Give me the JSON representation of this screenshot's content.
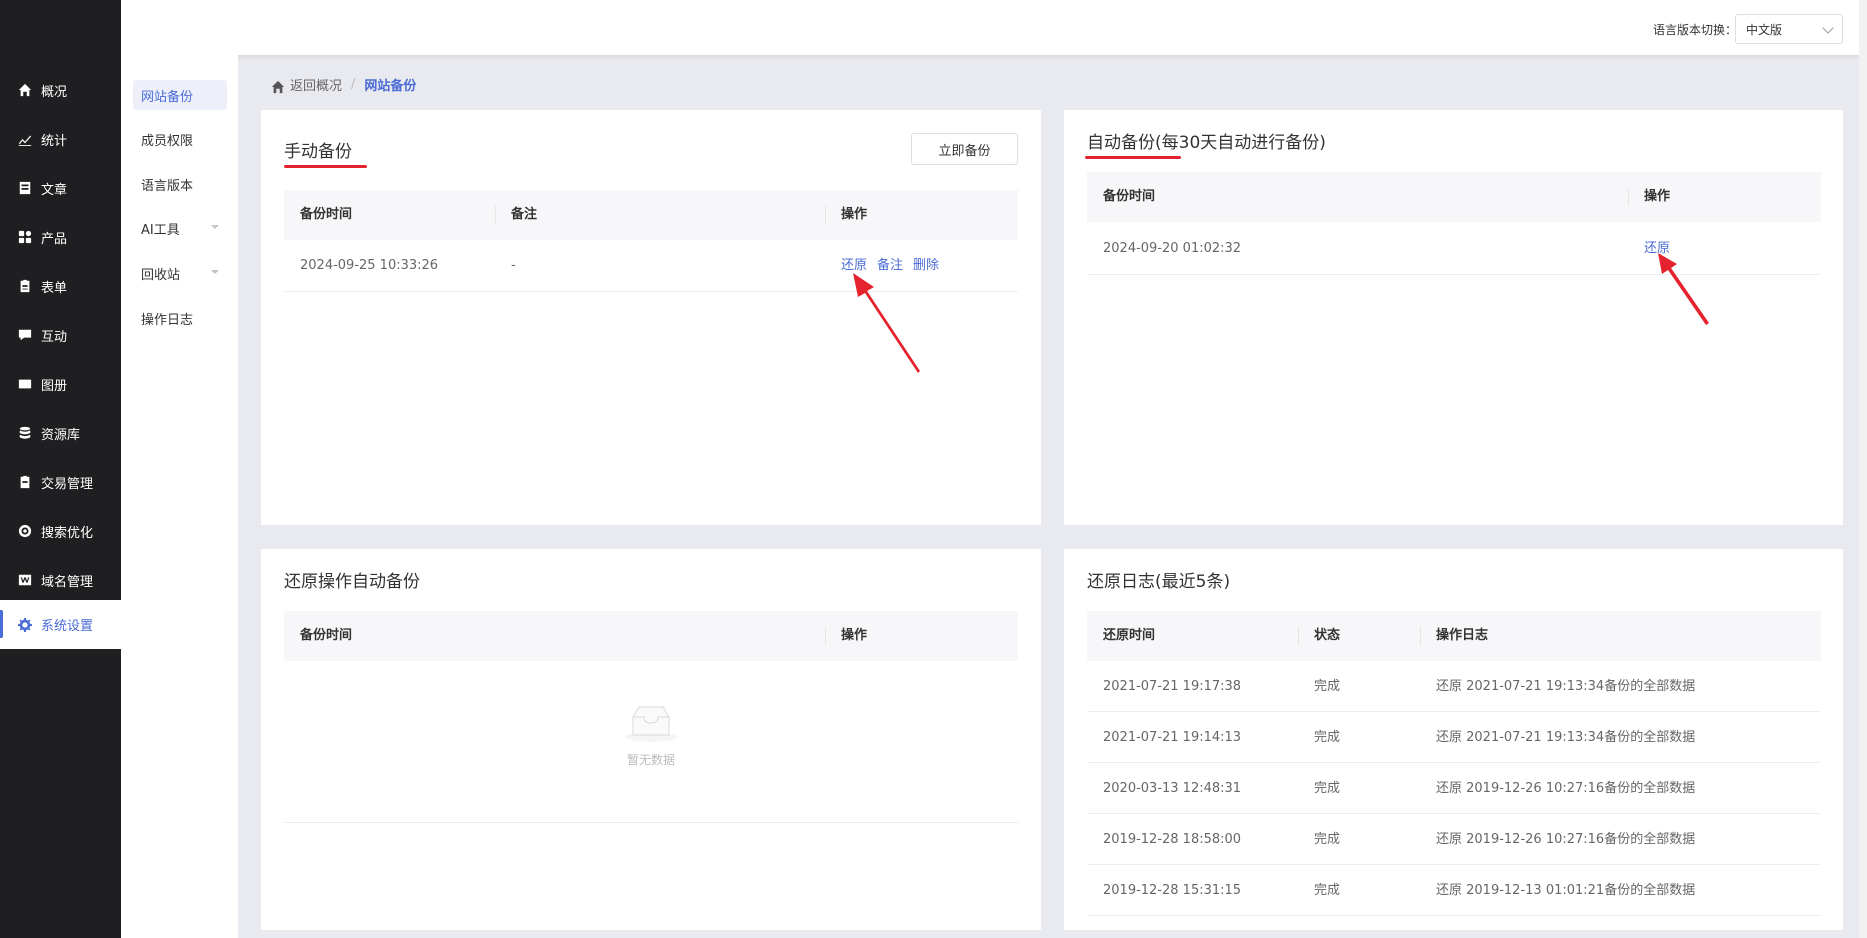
{
  "nav": {
    "items": [
      {
        "label": "概况",
        "icon": "home-icon"
      },
      {
        "label": "统计",
        "icon": "chart-icon"
      },
      {
        "label": "文章",
        "icon": "document-icon"
      },
      {
        "label": "产品",
        "icon": "grid-icon"
      },
      {
        "label": "表单",
        "icon": "clipboard-icon"
      },
      {
        "label": "互动",
        "icon": "chat-icon"
      },
      {
        "label": "图册",
        "icon": "album-icon"
      },
      {
        "label": "资源库",
        "icon": "database-icon"
      },
      {
        "label": "交易管理",
        "icon": "clipboard-icon"
      },
      {
        "label": "搜索优化",
        "icon": "target-icon"
      },
      {
        "label": "域名管理",
        "icon": "w-icon"
      },
      {
        "label": "系统设置",
        "icon": "gear-icon"
      }
    ]
  },
  "subnav": {
    "items": [
      {
        "label": "网站备份"
      },
      {
        "label": "成员权限"
      },
      {
        "label": "语言版本"
      },
      {
        "label": "AI工具"
      },
      {
        "label": "回收站"
      },
      {
        "label": "操作日志"
      }
    ]
  },
  "header": {
    "lang_label": "语言版本切换：",
    "lang_value": "中文版"
  },
  "breadcrumb": {
    "home": "返回概况",
    "sep": "/",
    "current": "网站备份"
  },
  "manual": {
    "title": "手动备份",
    "button": "立即备份",
    "headers": [
      "备份时间",
      "备注",
      "操作"
    ],
    "rows": [
      {
        "time": "2024-09-25 10:33:26",
        "note": "-",
        "actions": [
          "还原",
          "备注",
          "删除"
        ]
      }
    ]
  },
  "auto": {
    "title": "自动备份(每30天自动进行备份)",
    "headers": [
      "备份时间",
      "操作"
    ],
    "rows": [
      {
        "time": "2024-09-20 01:02:32",
        "action": "还原"
      }
    ]
  },
  "restore_auto": {
    "title": "还原操作自动备份",
    "headers": [
      "备份时间",
      "操作"
    ],
    "empty": "暂无数据"
  },
  "restore_log": {
    "title": "还原日志(最近5条)",
    "headers": [
      "还原时间",
      "状态",
      "操作日志"
    ],
    "rows": [
      {
        "time": "2021-07-21 19:17:38",
        "status": "完成",
        "log": "还原 2021-07-21 19:13:34备份的全部数据"
      },
      {
        "time": "2021-07-21 19:14:13",
        "status": "完成",
        "log": "还原 2021-07-21 19:13:34备份的全部数据"
      },
      {
        "time": "2020-03-13 12:48:31",
        "status": "完成",
        "log": "还原 2019-12-26 10:27:16备份的全部数据"
      },
      {
        "time": "2019-12-28 18:58:00",
        "status": "完成",
        "log": "还原 2019-12-26 10:27:16备份的全部数据"
      },
      {
        "time": "2019-12-28 15:31:15",
        "status": "完成",
        "log": "还原 2019-12-13 01:01:21备份的全部数据"
      }
    ]
  },
  "colors": {
    "accent": "#4b6bd6",
    "nav_bg": "#1f1f22",
    "annotation_red": "#e5232e"
  }
}
